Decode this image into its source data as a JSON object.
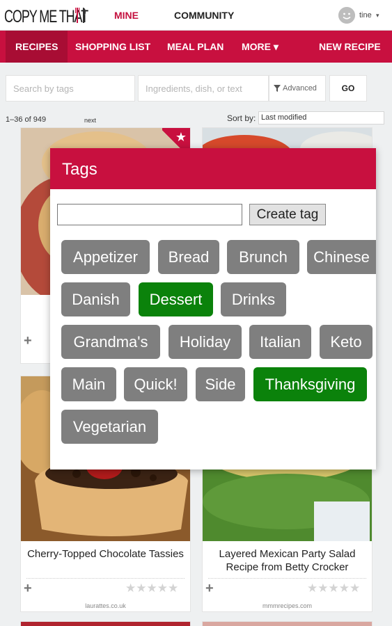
{
  "header": {
    "logo_text": "COPY ME THAT",
    "nav_mine": "MINE",
    "nav_community": "COMMUNITY",
    "user_name": "tine",
    "user_caret": "▾"
  },
  "navbar": {
    "recipes": "RECIPES",
    "shopping_list": "SHOPPING LIST",
    "meal_plan": "MEAL PLAN",
    "more": "MORE ▾",
    "new_recipe": "NEW RECIPE"
  },
  "search": {
    "tags_placeholder": "Search by tags",
    "main_placeholder": "Ingredients, dish, or text",
    "advanced_label": "Advanced",
    "go_label": "GO"
  },
  "results": {
    "count": "1–36 of 949",
    "next": "next",
    "sort_label": "Sort by:",
    "sort_value": "Last modified"
  },
  "recipes": [
    {
      "title": "Cherry-Topped Chocolate Tassies",
      "domain": "laurattes.co.uk",
      "stars": "★★★★★",
      "plus": "+"
    },
    {
      "title": "Layered Mexican Party Salad Recipe from Betty Crocker",
      "domain": "mmmrecipes.com",
      "stars": "★★★★★",
      "plus": "+"
    }
  ],
  "first_card_plus": "+",
  "first_card_star": "★",
  "modal": {
    "title": "Tags",
    "input_value": "",
    "create_label": "Create tag",
    "tags": [
      {
        "label": "Appetizer",
        "selected": false
      },
      {
        "label": "Bread",
        "selected": false
      },
      {
        "label": "Brunch",
        "selected": false
      },
      {
        "label": "Chinese",
        "selected": false
      },
      {
        "label": "Danish",
        "selected": false
      },
      {
        "label": "Dessert",
        "selected": true
      },
      {
        "label": "Drinks",
        "selected": false
      },
      {
        "label": "Grandma's",
        "selected": false
      },
      {
        "label": "Holiday",
        "selected": false
      },
      {
        "label": "Italian",
        "selected": false
      },
      {
        "label": "Keto",
        "selected": false
      },
      {
        "label": "Main",
        "selected": false
      },
      {
        "label": "Quick!",
        "selected": false
      },
      {
        "label": "Side",
        "selected": false
      },
      {
        "label": "Thanksgiving",
        "selected": true
      },
      {
        "label": "Vegetarian",
        "selected": false
      }
    ]
  },
  "colors": {
    "brand": "#c8103f",
    "tag_default": "#7f7f7f",
    "tag_selected": "#0b820b"
  }
}
